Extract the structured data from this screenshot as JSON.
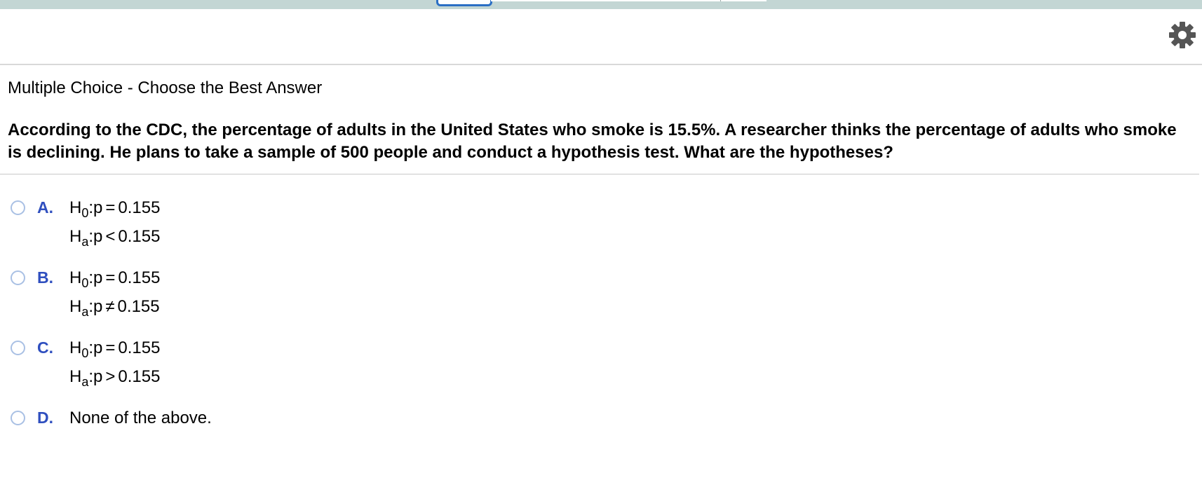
{
  "toolbar": {
    "settings_icon": "gear-icon"
  },
  "heading": "Multiple Choice - Choose the Best Answer",
  "question": "According to the CDC, the percentage of adults in the United States who smoke is 15.5%.  A researcher thinks the percentage of adults who smoke is declining.  He plans to take a sample of 500 people and conduct a hypothesis test.  What are the hypotheses?",
  "colors": {
    "letter": "#2f4fbf",
    "radio_border": "#a9c0e4",
    "top_strip": "#c3d6d4"
  },
  "choices": [
    {
      "letter": "A.",
      "null": {
        "H": "H",
        "sub": "0",
        "rest": ":p",
        "op": "=",
        "value": "0.155"
      },
      "alt": {
        "H": "H",
        "sub": "a",
        "rest": ":p",
        "op": "<",
        "value": "0.155"
      }
    },
    {
      "letter": "B.",
      "null": {
        "H": "H",
        "sub": "0",
        "rest": ":p",
        "op": "=",
        "value": "0.155"
      },
      "alt": {
        "H": "H",
        "sub": "a",
        "rest": ":p",
        "op": "≠",
        "value": "0.155"
      }
    },
    {
      "letter": "C.",
      "null": {
        "H": "H",
        "sub": "0",
        "rest": ":p",
        "op": "=",
        "value": "0.155"
      },
      "alt": {
        "H": "H",
        "sub": "a",
        "rest": ":p",
        "op": ">",
        "value": "0.155"
      }
    },
    {
      "letter": "D.",
      "text": "None of the above."
    }
  ]
}
